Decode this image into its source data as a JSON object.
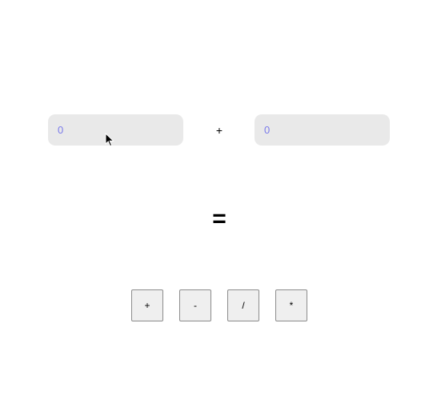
{
  "inputs": {
    "operand_a": {
      "value": "0",
      "placeholder": ""
    },
    "operand_b": {
      "value": "0",
      "placeholder": ""
    }
  },
  "operator_display": "+",
  "equals": "=",
  "buttons": {
    "add": "+",
    "subtract": "-",
    "divide": "/",
    "multiply": "*"
  },
  "colors": {
    "input_background": "#e9e9e9",
    "input_text": "#7b7bea",
    "button_background": "#efefef",
    "button_border": "#8c8c8c"
  }
}
